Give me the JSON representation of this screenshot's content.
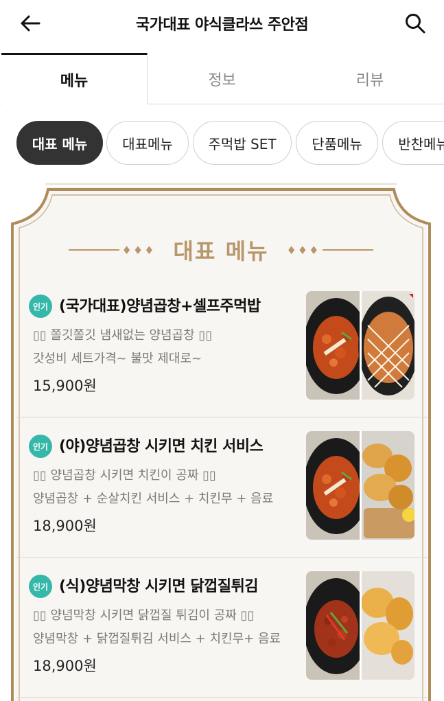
{
  "header": {
    "title": "국가대표 야식클라쓰 주안점"
  },
  "tabs": [
    {
      "label": "메뉴",
      "active": true
    },
    {
      "label": "정보",
      "active": false
    },
    {
      "label": "리뷰",
      "active": false
    }
  ],
  "chips": [
    {
      "label": "대표 메뉴",
      "active": true
    },
    {
      "label": "대표메뉴",
      "active": false
    },
    {
      "label": "주먹밥 SET",
      "active": false
    },
    {
      "label": "단품메뉴",
      "active": false
    },
    {
      "label": "반찬메뉴",
      "active": false
    }
  ],
  "section": {
    "title": "대표 메뉴"
  },
  "items": [
    {
      "badge": "인기",
      "name": "(국가대표)양념곱창+셀프주먹밥",
      "desc1": "▯▯ 쫄깃쫄깃 냄새없는 양념곱창 ▯▯",
      "desc2": "갓성비 세트가격~ 불맛 제대로~",
      "price": "15,900원",
      "photo_left": "spicy-gopchang",
      "photo_right": "mayo-rice-ball"
    },
    {
      "badge": "인기",
      "name": "(야)양념곱창 시키면 치킨 서비스",
      "desc1": "▯▯ 양념곱창 시키면 치킨이 공짜 ▯▯",
      "desc2": "양념곱창 + 순살치킨 서비스 + 치킨무 + 음료",
      "price": "18,900원",
      "photo_left": "spicy-gopchang",
      "photo_right": "fried-chicken"
    },
    {
      "badge": "인기",
      "name": "(식)양념막창 시키면 닭껍질튀김",
      "desc1": "▯▯ 양념막창 시키면 닭껍질 튀김이 공짜 ▯▯",
      "desc2": "양념막창 + 닭껍질튀김 서비스 + 치킨무+ 음료",
      "price": "18,900원",
      "photo_left": "spicy-makchang",
      "photo_right": "fried-chicken-skin"
    }
  ],
  "colors": {
    "accent_gold": "#b8966b",
    "frame_brown": "#b08b5c",
    "badge_teal": "#35b7a9",
    "chip_active": "#333333"
  }
}
